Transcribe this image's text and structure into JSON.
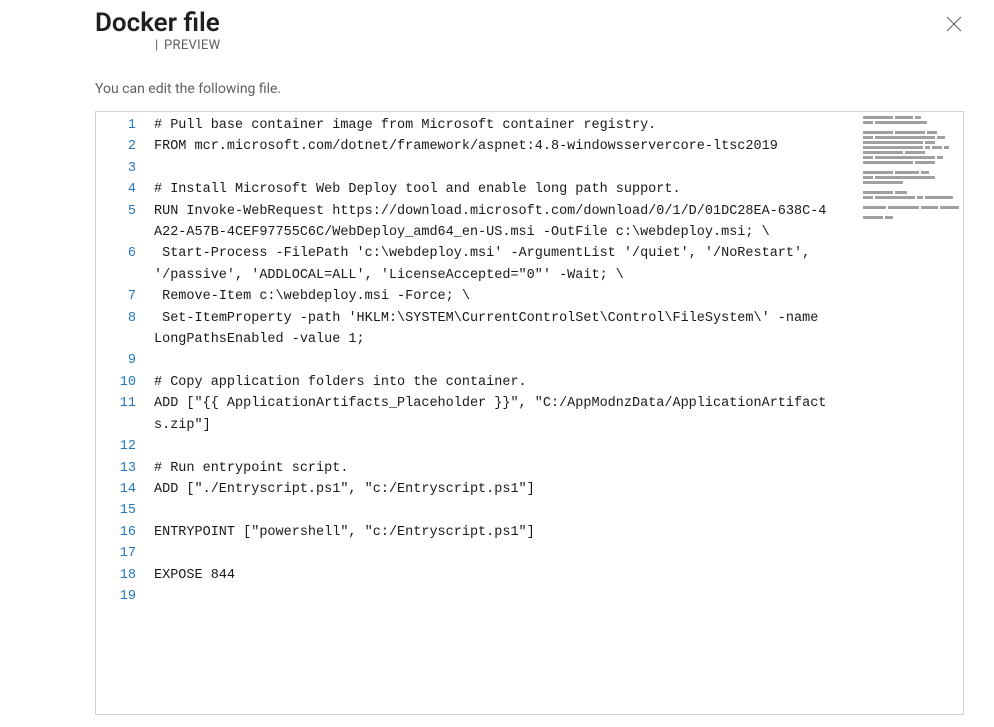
{
  "header": {
    "title": "Docker file",
    "preview_label": "PREVIEW"
  },
  "subheader": "You can edit the following file.",
  "editor": {
    "lines": [
      {
        "n": 1,
        "text": "# Pull base container image from Microsoft container registry."
      },
      {
        "n": 2,
        "text": "FROM mcr.microsoft.com/dotnet/framework/aspnet:4.8-windowsservercore-ltsc2019"
      },
      {
        "n": 3,
        "text": ""
      },
      {
        "n": 4,
        "text": "# Install Microsoft Web Deploy tool and enable long path support."
      },
      {
        "n": 5,
        "text": "RUN Invoke-WebRequest https://download.microsoft.com/download/0/1/D/01DC28EA-638C-4A22-A57B-4CEF97755C6C/WebDeploy_amd64_en-US.msi -OutFile c:\\webdeploy.msi; \\"
      },
      {
        "n": 6,
        "text": " Start-Process -FilePath 'c:\\webdeploy.msi' -ArgumentList '/quiet', '/NoRestart', '/passive', 'ADDLOCAL=ALL', 'LicenseAccepted=\"0\"' -Wait; \\"
      },
      {
        "n": 7,
        "text": " Remove-Item c:\\webdeploy.msi -Force; \\"
      },
      {
        "n": 8,
        "text": " Set-ItemProperty -path 'HKLM:\\SYSTEM\\CurrentControlSet\\Control\\FileSystem\\' -name LongPathsEnabled -value 1;"
      },
      {
        "n": 9,
        "text": ""
      },
      {
        "n": 10,
        "text": "# Copy application folders into the container."
      },
      {
        "n": 11,
        "text": "ADD [\"{{ ApplicationArtifacts_Placeholder }}\", \"C:/AppModnzData/ApplicationArtifacts.zip\"]"
      },
      {
        "n": 12,
        "text": ""
      },
      {
        "n": 13,
        "text": "# Run entrypoint script."
      },
      {
        "n": 14,
        "text": "ADD [\"./Entryscript.ps1\", \"c:/Entryscript.ps1\"]"
      },
      {
        "n": 15,
        "text": ""
      },
      {
        "n": 16,
        "text": "ENTRYPOINT [\"powershell\", \"c:/Entryscript.ps1\"]"
      },
      {
        "n": 17,
        "text": ""
      },
      {
        "n": 18,
        "text": "EXPOSE 844"
      },
      {
        "n": 19,
        "text": ""
      }
    ]
  },
  "minimap_segments": [
    [
      30,
      18,
      6
    ],
    [
      10,
      52
    ],
    [],
    [
      30,
      30,
      10
    ],
    [
      10,
      60,
      8
    ],
    [
      60,
      10
    ],
    [
      60,
      5,
      10,
      5
    ],
    [
      40,
      20
    ],
    [
      10,
      60,
      6
    ],
    [
      50,
      20
    ],
    [],
    [
      30,
      24,
      8
    ],
    [
      10,
      60
    ],
    [
      40
    ],
    [],
    [
      30,
      12
    ],
    [
      10,
      40,
      6,
      28
    ],
    [],
    [
      24,
      32,
      18,
      20
    ],
    [],
    [
      20,
      8
    ]
  ]
}
